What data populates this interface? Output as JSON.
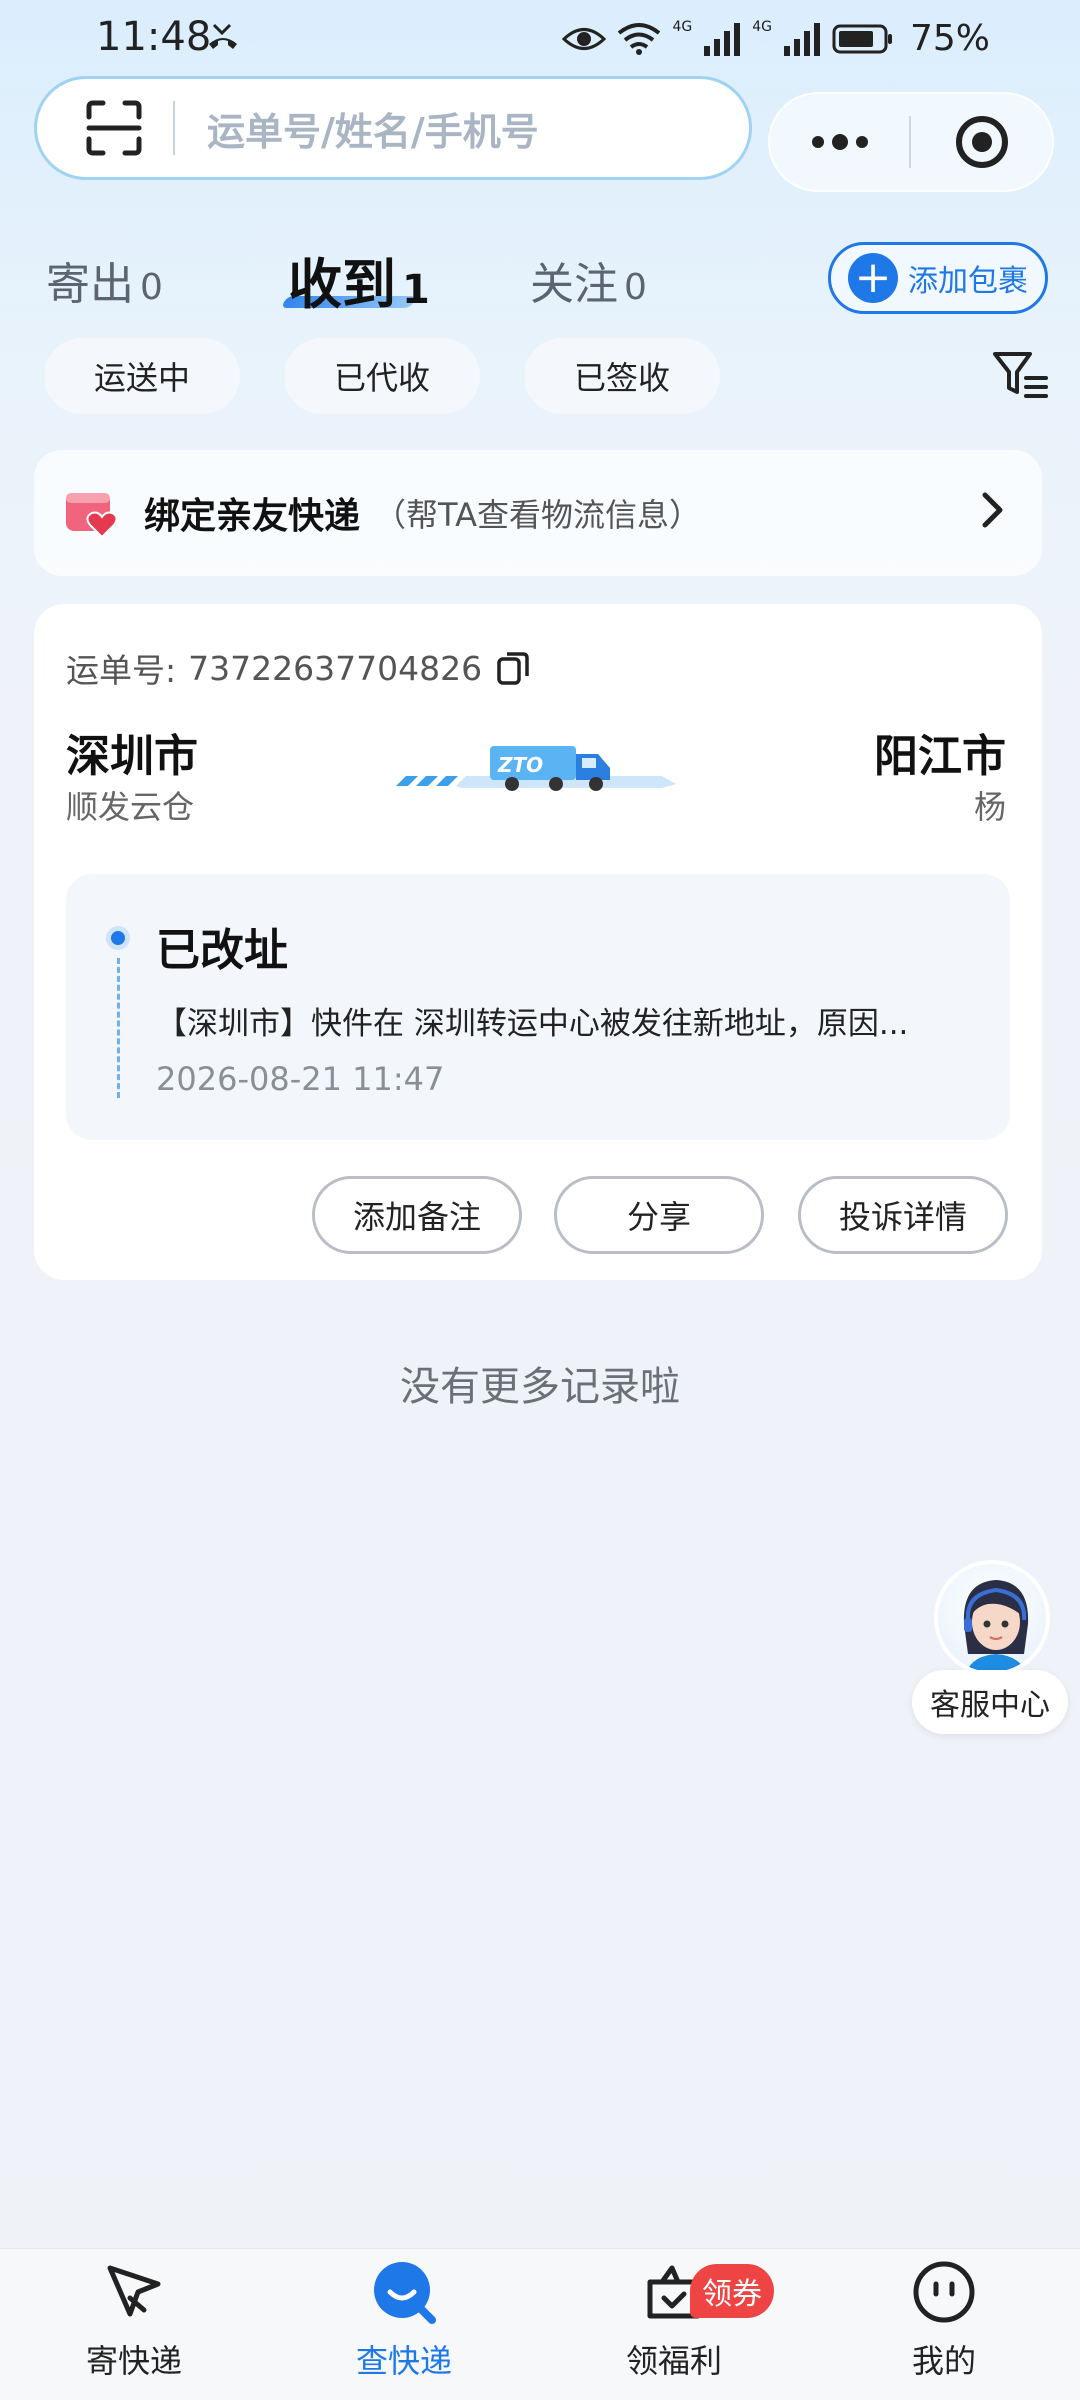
{
  "status_bar": {
    "time": "11:48",
    "battery": "75%",
    "net1": "4G",
    "net2": "4G"
  },
  "search": {
    "placeholder": "运单号/姓名/手机号"
  },
  "tabs": [
    {
      "label": "寄出",
      "count": "0"
    },
    {
      "label": "收到",
      "count": "1"
    },
    {
      "label": "关注",
      "count": "0"
    }
  ],
  "add_package_label": "添加包裹",
  "chips": [
    "运送中",
    "已代收",
    "已签收"
  ],
  "bind_banner": {
    "title": "绑定亲友快递",
    "subtitle": "（帮TA查看物流信息）"
  },
  "package": {
    "waybill_label": "运单号:",
    "waybill_number": "73722637704826",
    "origin_city": "深圳市",
    "origin_sub": "顺发云仓",
    "dest_city": "阳江市",
    "dest_sub": "杨",
    "courier_logo": "ZTO",
    "status": "已改址",
    "detail": "【深圳市】快件在 深圳转运中心被发往新地址，原因...",
    "time": "2026-08-21 11:47"
  },
  "actions": {
    "note": "添加备注",
    "share": "分享",
    "complaint": "投诉详情"
  },
  "no_more": "没有更多记录啦",
  "customer_service": "客服中心",
  "bottom_nav": [
    {
      "label": "寄快递",
      "icon": "send-icon"
    },
    {
      "label": "查快递",
      "icon": "search-package-icon"
    },
    {
      "label": "领福利",
      "icon": "gift-icon",
      "badge": "领券"
    },
    {
      "label": "我的",
      "icon": "profile-icon"
    }
  ],
  "colors": {
    "accent": "#1e78e8",
    "badge": "#ef4444"
  }
}
